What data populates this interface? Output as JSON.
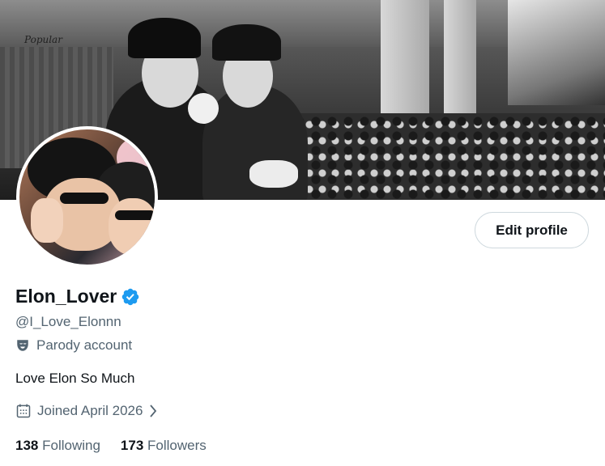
{
  "banner": {
    "sign_text": "Popular"
  },
  "profile": {
    "display_name": "Elon_Lover",
    "verified_icon": "verified-badge-icon",
    "verified_color": "#1d9bf0",
    "handle": "@I_Love_Elonnn",
    "parody_label": "Parody account",
    "bio": "Love Elon So Much",
    "joined": "Joined April 2026",
    "following_count": "138",
    "following_label": "Following",
    "followers_count": "173",
    "followers_label": "Followers"
  },
  "actions": {
    "edit_profile_label": "Edit profile"
  }
}
